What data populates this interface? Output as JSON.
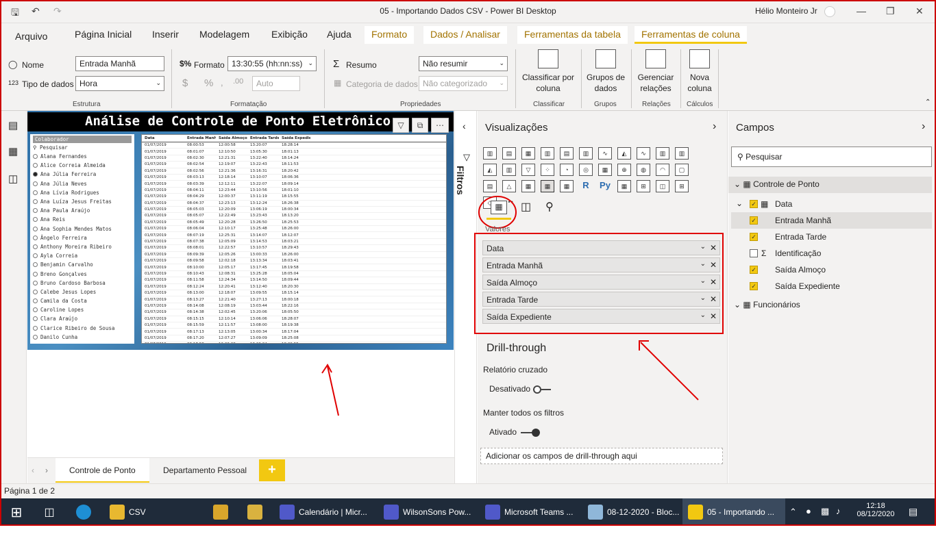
{
  "window": {
    "title": "05 - Importando Dados CSV - Power BI Desktop",
    "user": "Hélio Monteiro Jr"
  },
  "menu": {
    "tabs": [
      "Arquivo",
      "Página Inicial",
      "Inserir",
      "Modelagem",
      "Exibição",
      "Ajuda"
    ],
    "context_tabs": [
      "Formato",
      "Dados / Analisar",
      "Ferramentas da tabela",
      "Ferramentas de coluna"
    ]
  },
  "ribbon": {
    "estrutura": {
      "nome_label": "Nome",
      "nome_value": "Entrada Manhã",
      "tipo_label": "Tipo de dados",
      "tipo_value": "Hora",
      "group": "Estrutura"
    },
    "formatacao": {
      "formato_label": "Formato",
      "formato_value": "13:30:55 (hh:nn:ss)",
      "currency": "$",
      "percent": "%",
      "auto_value": "Auto",
      "group": "Formatação"
    },
    "propriedades": {
      "resumo_label": "Resumo",
      "resumo_value": "Não resumir",
      "categoria_label": "Categoria de dados",
      "categoria_value": "Não categorizado",
      "group": "Propriedades"
    },
    "classificar": {
      "button": "Classificar por coluna",
      "group": "Classificar"
    },
    "grupos": {
      "button": "Grupos de dados",
      "group": "Grupos"
    },
    "relacoes": {
      "button": "Gerenciar relações",
      "group": "Relações"
    },
    "calculos": {
      "button": "Nova coluna",
      "group": "Cálculos"
    }
  },
  "report": {
    "title": "Análise de Controle de Ponto Eletrônico",
    "slicer": {
      "header": "Colaborador",
      "search": "Pesquisar",
      "selected": "Ana Júlia Ferreira",
      "items": [
        "Alana Fernandes",
        "Alice Correia Almeida",
        "Ana Júlia Ferreira",
        "Ana Júlia Neves",
        "Ana Lívia Rodrigues",
        "Ana Luíza Jesus Freitas",
        "Ana Paula Araújo",
        "Ana Reis",
        "Ana Sophia Mendes Matos",
        "Ângelo Ferreira",
        "Anthony Moreira Ribeiro",
        "Ayla Correia",
        "Benjamin Carvalho",
        "Breno Gonçalves",
        "Bruno Cardoso Barbosa",
        "Calebe Jesus Lopes",
        "Camila da Costa",
        "Caroline Lopes",
        "Clara Araújo",
        "Clarice Ribeiro de Sousa",
        "Danilo Cunha"
      ]
    },
    "table": {
      "columns": [
        "Data",
        "Entrada Manhã",
        "Saída Almoço",
        "Entrada Tarde",
        "Saída Expediente"
      ],
      "rows": [
        [
          "01/07/2019",
          "08:00:53",
          "12:00:58",
          "13:20:07",
          "18:28:14"
        ],
        [
          "01/07/2019",
          "08:01:07",
          "12:10:50",
          "13:05:30",
          "18:01:13"
        ],
        [
          "01/07/2019",
          "08:02:30",
          "12:21:31",
          "13:22:40",
          "18:14:24"
        ],
        [
          "01/07/2019",
          "08:02:54",
          "12:19:07",
          "13:22:43",
          "18:11:53"
        ],
        [
          "01/07/2019",
          "08:02:56",
          "12:21:36",
          "13:16:31",
          "18:20:42"
        ],
        [
          "01/07/2019",
          "08:03:13",
          "12:18:14",
          "13:10:07",
          "18:06:36"
        ],
        [
          "01/07/2019",
          "08:03:39",
          "12:12:11",
          "13:22:07",
          "18:09:14"
        ],
        [
          "01/07/2019",
          "08:04:11",
          "12:23:44",
          "13:10:56",
          "18:01:10"
        ],
        [
          "01/07/2019",
          "08:04:29",
          "12:00:37",
          "13:11:19",
          "18:15:55"
        ],
        [
          "01/07/2019",
          "08:04:37",
          "12:23:13",
          "13:12:24",
          "18:26:38"
        ],
        [
          "01/07/2019",
          "08:05:03",
          "12:20:09",
          "13:06:19",
          "18:00:34"
        ],
        [
          "01/07/2019",
          "08:05:07",
          "12:22:49",
          "13:23:43",
          "18:13:20"
        ],
        [
          "01/07/2019",
          "08:05:49",
          "12:20:28",
          "13:26:50",
          "18:25:53"
        ],
        [
          "01/07/2019",
          "08:06:04",
          "12:10:17",
          "13:25:48",
          "18:26:00"
        ],
        [
          "01/07/2019",
          "08:07:19",
          "12:25:31",
          "13:14:07",
          "18:12:07"
        ],
        [
          "01/07/2019",
          "08:07:38",
          "12:05:09",
          "13:14:53",
          "18:03:21"
        ],
        [
          "01/07/2019",
          "08:08:01",
          "12:22:57",
          "13:10:57",
          "18:29:43"
        ],
        [
          "01/07/2019",
          "08:09:39",
          "12:05:26",
          "13:00:33",
          "18:26:00"
        ],
        [
          "01/07/2019",
          "08:09:58",
          "12:02:18",
          "13:13:34",
          "18:03:41"
        ],
        [
          "01/07/2019",
          "08:10:00",
          "12:05:17",
          "13:17:45",
          "18:19:58"
        ],
        [
          "01/07/2019",
          "08:10:43",
          "12:08:31",
          "13:25:28",
          "18:05:04"
        ],
        [
          "01/07/2019",
          "08:11:58",
          "12:24:34",
          "13:14:50",
          "18:09:44"
        ],
        [
          "01/07/2019",
          "08:12:24",
          "12:20:41",
          "13:12:40",
          "18:20:30"
        ],
        [
          "01/07/2019",
          "08:13:00",
          "12:18:07",
          "13:09:55",
          "18:15:14"
        ],
        [
          "01/07/2019",
          "08:13:27",
          "12:21:40",
          "13:27:13",
          "18:00:18"
        ],
        [
          "01/07/2019",
          "08:14:08",
          "12:08:19",
          "13:03:44",
          "18:22:16"
        ],
        [
          "01/07/2019",
          "08:14:38",
          "12:02:45",
          "13:20:06",
          "18:05:50"
        ],
        [
          "01/07/2019",
          "08:15:15",
          "12:10:14",
          "13:06:06",
          "18:28:07"
        ],
        [
          "01/07/2019",
          "08:15:59",
          "12:11:57",
          "13:08:00",
          "18:19:38"
        ],
        [
          "01/07/2019",
          "08:17:13",
          "12:13:05",
          "13:00:34",
          "18:17:04"
        ],
        [
          "01/07/2019",
          "08:17:20",
          "12:07:27",
          "13:09:09",
          "18:25:08"
        ],
        [
          "01/07/2019",
          "08:17:58",
          "12:23:38",
          "13:26:04",
          "18:29:55"
        ],
        [
          "01/07/2019",
          "08:18:33",
          "12:13:43",
          "13:07:09",
          "18:12:30"
        ]
      ]
    }
  },
  "pages": {
    "tabs": [
      "Controle de Ponto",
      "Departamento Pessoal"
    ],
    "add": "+",
    "status": "Página 1 de 2"
  },
  "filters": {
    "label": "Filtros"
  },
  "visualizations": {
    "title": "Visualizações",
    "values_label": "Valores",
    "wells": [
      "Data",
      "Entrada Manhã",
      "Saída Almoço",
      "Entrada Tarde",
      "Saída Expediente"
    ],
    "drillthrough": {
      "title": "Drill-through",
      "cross_report": "Relatório cruzado",
      "cross_state": "Desativado",
      "keep_filters": "Manter todos os filtros",
      "keep_state": "Ativado",
      "drop_hint": "Adicionar os campos de drill-through aqui"
    }
  },
  "fields": {
    "title": "Campos",
    "search": "Pesquisar",
    "tables": [
      {
        "name": "Controle de Ponto",
        "children": [
          {
            "name": "Data",
            "checked": true
          },
          {
            "name": "Entrada Manhã",
            "checked": true
          },
          {
            "name": "Entrada Tarde",
            "checked": true
          },
          {
            "name": "Identificação",
            "checked": false
          },
          {
            "name": "Saída Almoço",
            "checked": true
          },
          {
            "name": "Saída Expediente",
            "checked": true
          }
        ]
      },
      {
        "name": "Funcionários"
      }
    ]
  },
  "taskbar": {
    "items": [
      "CSV",
      "Calendário | Micr...",
      "WilsonSons Pow...",
      "Microsoft Teams ...",
      "08-12-2020 - Bloc...",
      "05 - Importando ..."
    ],
    "time": "12:18",
    "date": "08/12/2020"
  },
  "colors": {
    "accent": "#f2c811",
    "annotation": "#e00000",
    "taskbar": "#1f2b3a"
  }
}
